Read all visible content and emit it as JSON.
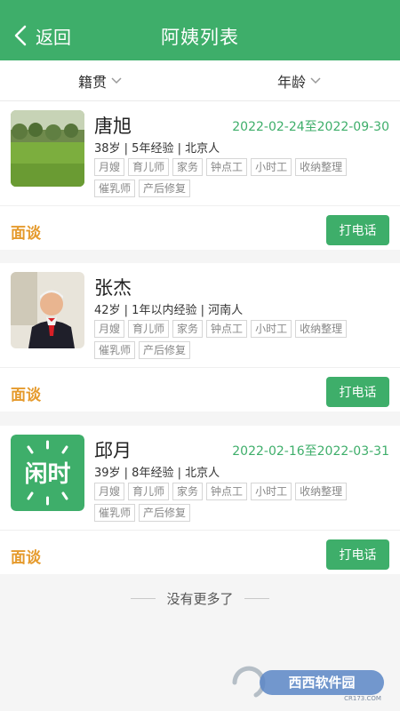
{
  "header": {
    "back_label": "返回",
    "title": "阿姨列表"
  },
  "filters": {
    "origin": "籍贯",
    "age": "年龄"
  },
  "actions": {
    "interview": "面谈",
    "call": "打电话"
  },
  "cards": [
    {
      "name": "唐旭",
      "date_range": "2022-02-24至2022-09-30",
      "meta": "38岁 | 5年经验 | 北京人",
      "tags": [
        "月嫂",
        "育儿师",
        "家务",
        "钟点工",
        "小时工",
        "收纳整理",
        "催乳师",
        "产后修复"
      ],
      "avatar": "park-lawn-photo"
    },
    {
      "name": "张杰",
      "date_range": "",
      "meta": "42岁 | 1年以内经验 | 河南人",
      "tags": [
        "月嫂",
        "育儿师",
        "家务",
        "钟点工",
        "小时工",
        "收纳整理",
        "催乳师",
        "产后修复"
      ],
      "avatar": "elderly-man-photo"
    },
    {
      "name": "邱月",
      "date_range": "2022-02-16至2022-03-31",
      "meta": "39岁 | 8年经验 | 北京人",
      "tags": [
        "月嫂",
        "育儿师",
        "家务",
        "钟点工",
        "小时工",
        "收纳整理",
        "催乳师",
        "产后修复"
      ],
      "avatar": "xianshi-logo",
      "avatar_text": "闲时"
    }
  ],
  "footer": {
    "no_more": "没有更多了"
  },
  "watermark": {
    "text": "西西软件园",
    "sub": "CR173.COM"
  },
  "colors": {
    "accent": "#3eae6a",
    "interview": "#e59a2c"
  }
}
